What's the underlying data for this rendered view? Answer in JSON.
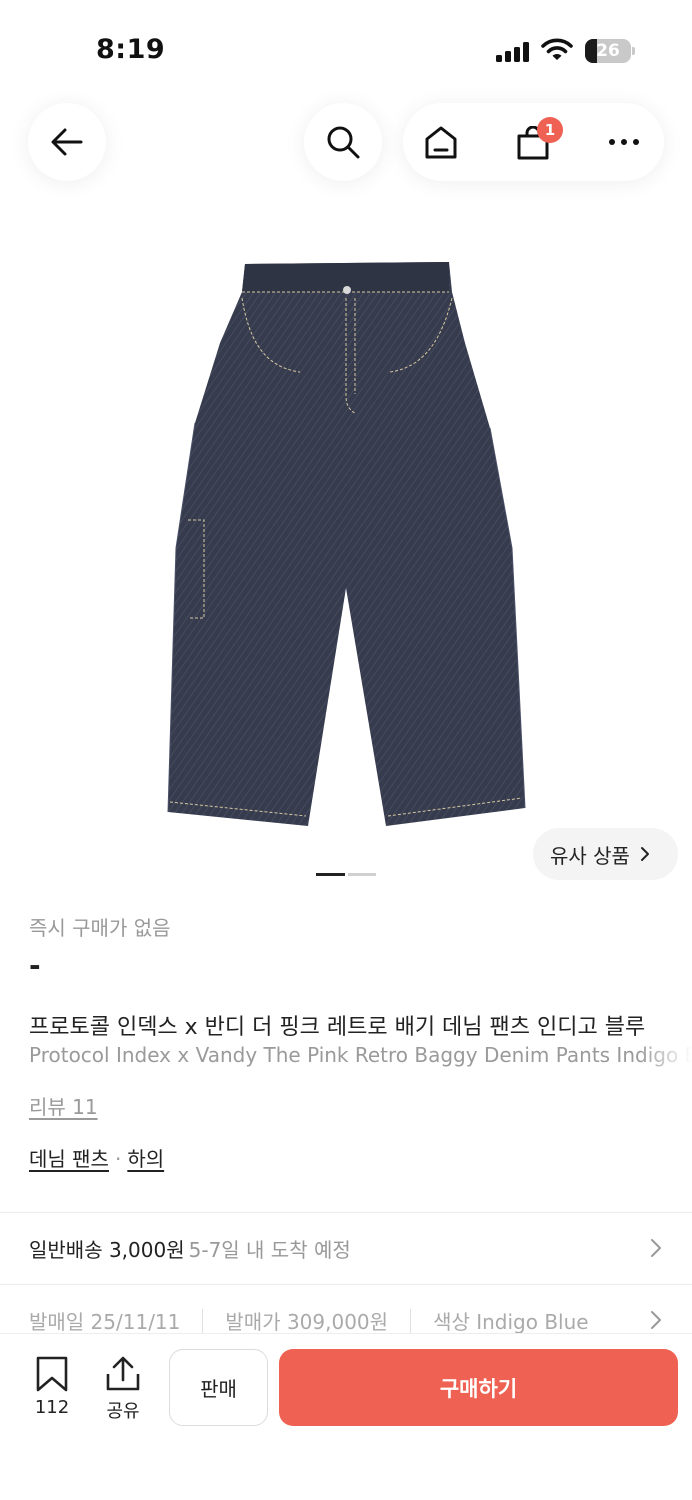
{
  "status_bar": {
    "time": "8:19",
    "battery": "26"
  },
  "header": {
    "icons": [
      "back-arrow-icon",
      "search-icon",
      "home-icon",
      "shopping-bag-icon",
      "more-icon"
    ],
    "cart_count": "1"
  },
  "gallery": {
    "image": "indigo-denim-pants-photo",
    "similar_label": "유사 상품",
    "page_count": 2,
    "active_page": 1
  },
  "product": {
    "instant_buy_note": "즉시 구매가 없음",
    "instant_price": "-",
    "title_ko": "프로토콜 인덱스 x 반디 더 핑크 레트로 배기 데님 팬츠 인디고 블루",
    "title_en": "Protocol Index x Vandy The Pink Retro Baggy Denim Pants Indigo Blue",
    "review_label": "리뷰 11",
    "category_main": "데님 팬츠",
    "category_separator": "·",
    "category_sub": "하의"
  },
  "shipping": {
    "label": "일반배송 3,000원",
    "eta": "5-7일 내 도착 예정"
  },
  "details": {
    "release_date": "발매일 25/11/11",
    "release_price": "발매가 309,000원",
    "color": "색상 Indigo Blue"
  },
  "bottom_bar": {
    "bookmark_count": "112",
    "share_label": "공유",
    "sell_label": "판매",
    "buy_label": "구매하기"
  },
  "colors": {
    "accent": "#ef6253",
    "denim": "#363b4d",
    "stitch": "#d8c9a3"
  }
}
